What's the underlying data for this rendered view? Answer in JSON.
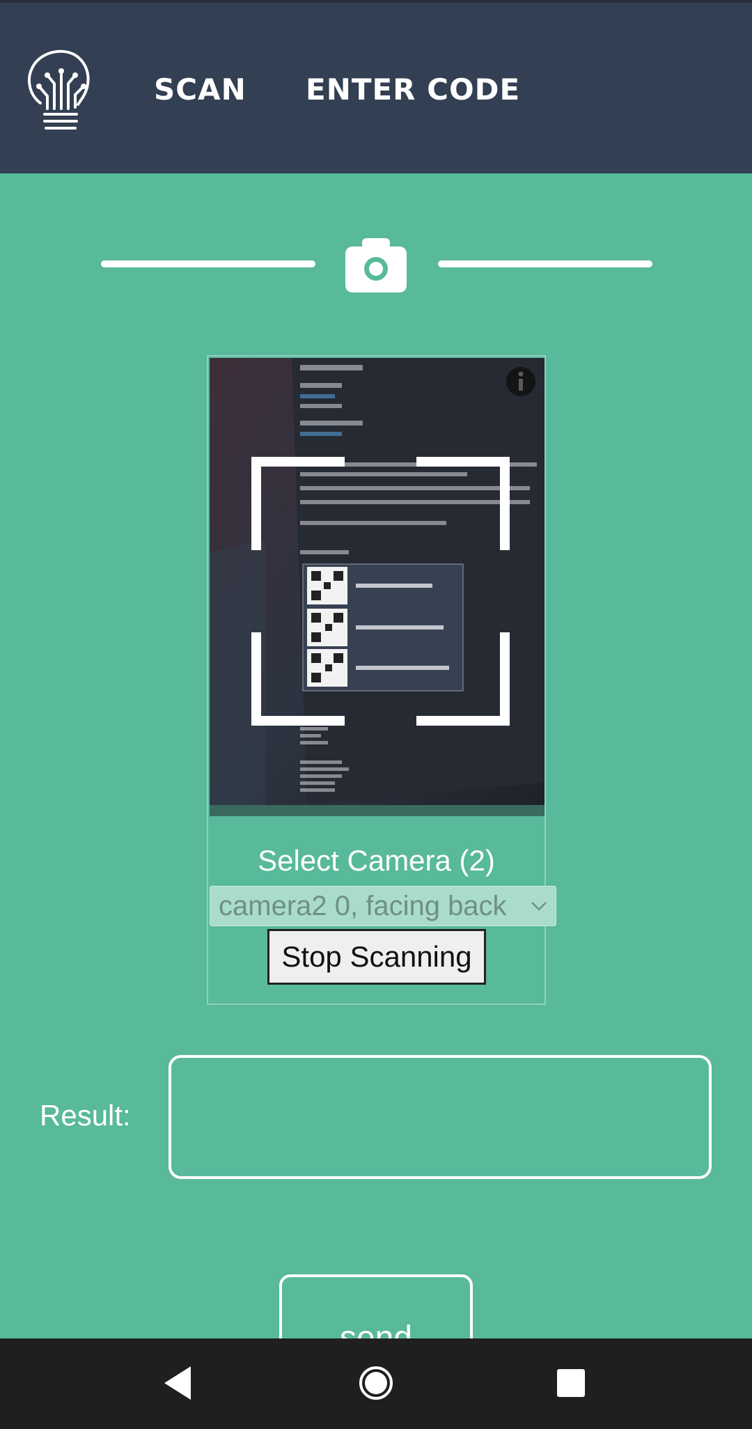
{
  "header": {
    "nav": [
      {
        "label": "SCAN"
      },
      {
        "label": "ENTER CODE"
      }
    ],
    "logo_icon": "lightbulb-circuit-logo"
  },
  "section_icon": "camera-icon",
  "scanner": {
    "select_label": "Select Camera (2)",
    "camera_selected": "camera2 0, facing back",
    "stop_label": "Stop Scanning",
    "info_icon": "info-icon"
  },
  "result": {
    "label": "Result:",
    "value": ""
  },
  "send": {
    "label": "send"
  },
  "colors": {
    "background": "#58b99b",
    "header": "#333f52",
    "navbar": "#1f1f1f"
  }
}
